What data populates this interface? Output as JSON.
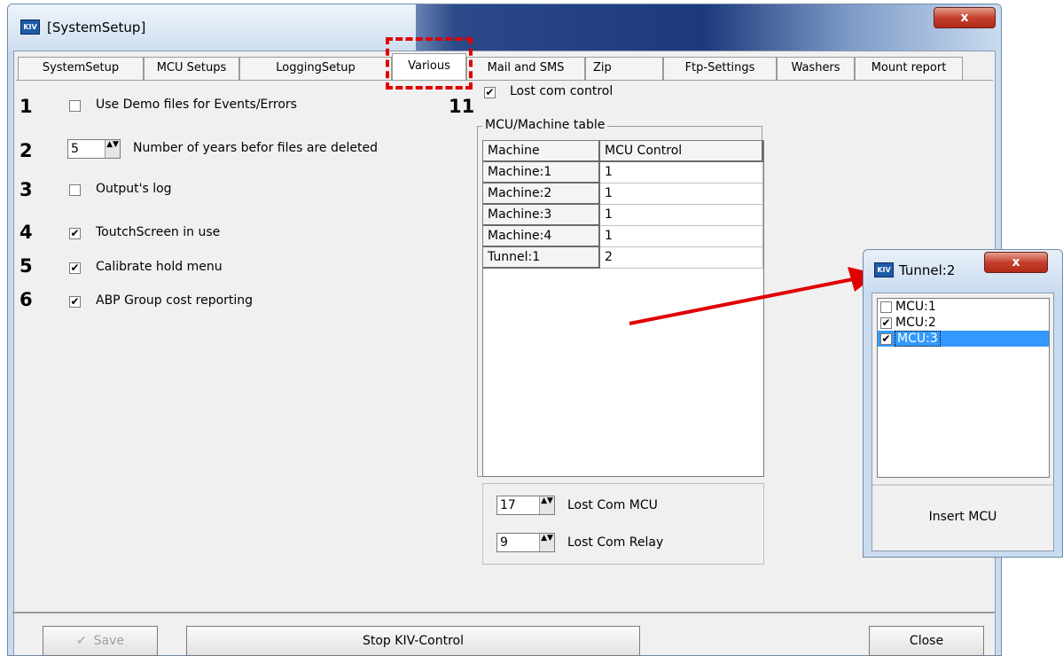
{
  "window": {
    "title": "[SystemSetup]",
    "close_glyph": "x",
    "app_icon_label": "KIV"
  },
  "tabs": [
    {
      "label": "SystemSetup",
      "active": false
    },
    {
      "label": "MCU Setups",
      "active": false
    },
    {
      "label": "LoggingSetup",
      "active": false
    },
    {
      "label": "Various",
      "active": true
    },
    {
      "label": "Mail and SMS",
      "active": false
    },
    {
      "label": "Zip",
      "active": false
    },
    {
      "label": "Ftp-Settings",
      "active": false
    },
    {
      "label": "Washers",
      "active": false
    },
    {
      "label": "Mount report",
      "active": false
    }
  ],
  "options": [
    {
      "num": "1",
      "label": "Use Demo files for Events/Errors",
      "checked": false
    },
    {
      "num": "2",
      "label": "Number of years befor files are deleted",
      "value": "5"
    },
    {
      "num": "3",
      "label": "Output's log",
      "checked": false
    },
    {
      "num": "4",
      "label": "ToutchScreen in use",
      "checked": true
    },
    {
      "num": "5",
      "label": "Calibrate hold menu",
      "checked": true
    },
    {
      "num": "6",
      "label": "ABP Group cost reporting",
      "checked": true
    }
  ],
  "lost_com": {
    "num": "11",
    "label": "Lost com control",
    "checked": true
  },
  "mcu_table": {
    "group_title": "MCU/Machine table",
    "headers": [
      "Machine",
      "MCU Control"
    ],
    "rows": [
      [
        "Machine:1",
        "1"
      ],
      [
        "Machine:2",
        "1"
      ],
      [
        "Machine:3",
        "1"
      ],
      [
        "Machine:4",
        "1"
      ],
      [
        "Tunnel:1",
        "2"
      ]
    ]
  },
  "lost_settings": {
    "mcu_value": "17",
    "mcu_label": "Lost Com MCU",
    "relay_value": "9",
    "relay_label": "Lost Com Relay"
  },
  "buttons": {
    "save": "Save",
    "stop": "Stop KIV-Control",
    "close": "Close"
  },
  "popup": {
    "title": "Tunnel:2",
    "close_glyph": "x",
    "items": [
      {
        "label": "MCU:1",
        "checked": false,
        "selected": false
      },
      {
        "label": "MCU:2",
        "checked": true,
        "selected": false
      },
      {
        "label": "MCU:3",
        "checked": true,
        "selected": true
      }
    ],
    "insert_button": "Insert MCU"
  },
  "colors": {
    "annotation": "#e00000",
    "selection": "#3399ff"
  },
  "glyphs": {
    "check": "✔",
    "spin": "▲▼"
  }
}
